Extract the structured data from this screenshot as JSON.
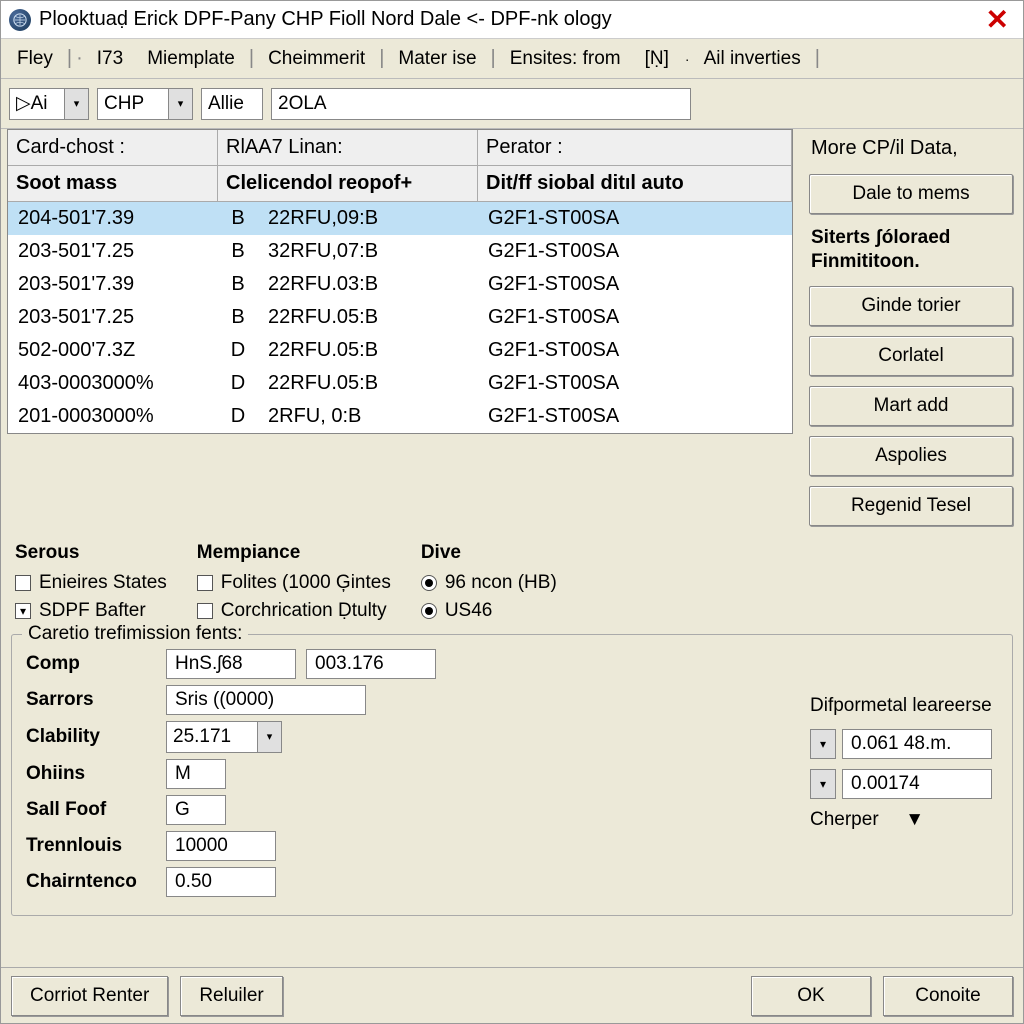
{
  "title": "Plooktuaḍ Erick DPF-Pany CHP Fioll Nord Dale <- DPF-nk ology",
  "menu": {
    "fley": "Fley",
    "i73": "I73",
    "miemplate": "Miemplate",
    "cheimmerit": "Cheimmerit",
    "materise": "Mater ise",
    "ensites": "Ensites: from",
    "ensites_icon": "[Ṇ]",
    "ail": "Ail inverties"
  },
  "toolbar": {
    "ai_icon": "▷Ai",
    "chp": "CHP",
    "allie": "Allie",
    "ola": "2OLA"
  },
  "right": {
    "more": "More CP/il Data,",
    "dale": "Dale to mems",
    "siterts": "Siterts ʃóloraed\nFinmititoon.",
    "ginde": "Ginde torier",
    "corlatel": "Corlatel",
    "mart": "Mart add",
    "aspolies": "Aspolies",
    "regenid": "Regenid Tesel"
  },
  "headers1": {
    "card": "Card-chost :",
    "riaa": "RlAA7 Linan:",
    "perator": "Perator :"
  },
  "headers2": {
    "soot": "Soot mass",
    "clel": "Clelicendol reopof+",
    "ditff": "Dit/ff siobal ditıl auto"
  },
  "rows": [
    {
      "c1": "204-501'7.39",
      "c2": "B",
      "c3": "22RFU,09:B",
      "c4": "G2F1-ST00SA"
    },
    {
      "c1": "203-501'7.25",
      "c2": "B",
      "c3": "32RFU,07:B",
      "c4": "G2F1-ST00SA"
    },
    {
      "c1": "203-501'7.39",
      "c2": "B",
      "c3": "22RFU.03:B",
      "c4": "G2F1-ST00SA"
    },
    {
      "c1": "203-501'7.25",
      "c2": "B",
      "c3": "22RFU.05:B",
      "c4": "G2F1-ST00SA"
    },
    {
      "c1": "502-000'7.3Z",
      "c2": "D",
      "c3": "22RFU.05:B",
      "c4": "G2F1-ST00SA"
    },
    {
      "c1": "403-0003000%",
      "c2": "D",
      "c3": "22RFU.05:B",
      "c4": "G2F1-ST00SA"
    },
    {
      "c1": "201-0003000%",
      "c2": "D",
      "c3": " 2RFU,  0:B",
      "c4": "G2F1-ST00SA"
    }
  ],
  "opts": {
    "serous": "Serous",
    "enieires": "Enieires States",
    "sdpf": "SDPF Bafter",
    "mempiance": "Mempiance",
    "folites": "Folites (1000 Ģintes",
    "corch": "Corchrication Ḍtulty",
    "dive": "Dive",
    "ncon": "96 ncon (HB)",
    "us46": "US46"
  },
  "fieldset": {
    "legend": "Caretio trefimission fents:",
    "comp": "Comp",
    "comp_v1": "HnS.ʃ68",
    "comp_v2": "003.176",
    "sarrors": "Sarrors",
    "sarrors_v": "Sris ((0000)",
    "clability": "Clability",
    "clability_v": "25.171",
    "ohins": "Ohiins",
    "ohins_v": "M",
    "sallfoot": "Sall Foof",
    "sallfoot_v": "G",
    "trennlouis": "Trennlouis",
    "trennlouis_v": "10000",
    "chairntenco": "Chairntenco",
    "chairntenco_v": "0.50",
    "difpormetal": "Difpormetal leareerse",
    "dif_v1": "0.061 48.m.",
    "dif_v2": "0.00174",
    "cherper": "Cherper"
  },
  "bottom": {
    "corriot": "Corriot Renter",
    "reluiler": "Reluiler",
    "ok": "OK",
    "conoite": "Conoite"
  }
}
